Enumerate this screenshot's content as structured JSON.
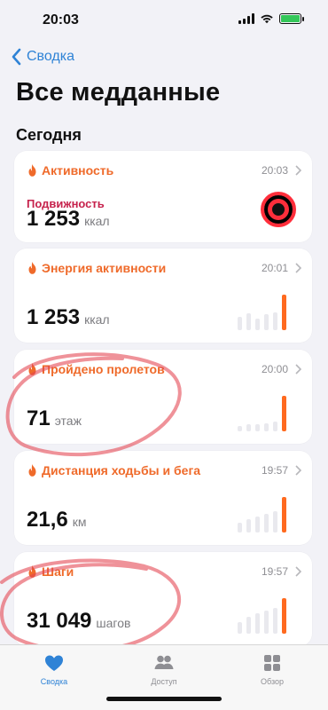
{
  "status": {
    "time": "20:03",
    "battery_color": "#34c759"
  },
  "nav": {
    "back_label": "Сводка",
    "title": "Все медданные",
    "section": "Сегодня"
  },
  "cards": [
    {
      "title": "Активность",
      "time": "20:03",
      "subtitle": "Подвижность",
      "value": "1 253",
      "unit": "ккал",
      "icon": "flame-icon",
      "accent": "#ef6a2a"
    },
    {
      "title": "Энергия активности",
      "time": "20:01",
      "value": "1 253",
      "unit": "ккал",
      "icon": "flame-icon",
      "sparkline": [
        0.35,
        0.45,
        0.3,
        0.42,
        0.48,
        0.95
      ]
    },
    {
      "title": "Пройдено пролетов",
      "time": "20:00",
      "value": "71",
      "unit": "этаж",
      "icon": "flame-icon",
      "sparkline": [
        0.15,
        0.2,
        0.18,
        0.22,
        0.27,
        0.95
      ]
    },
    {
      "title": "Дистанция ходьбы и бега",
      "time": "19:57",
      "value": "21,6",
      "unit": "км",
      "icon": "flame-icon",
      "sparkline": [
        0.25,
        0.35,
        0.42,
        0.5,
        0.58,
        0.95
      ]
    },
    {
      "title": "Шаги",
      "time": "19:57",
      "value": "31 049",
      "unit": "шагов",
      "icon": "flame-icon",
      "sparkline": [
        0.3,
        0.45,
        0.55,
        0.62,
        0.7,
        0.95
      ]
    }
  ],
  "tabs": [
    {
      "label": "Сводка",
      "icon": "heart-icon",
      "selected": true
    },
    {
      "label": "Доступ",
      "icon": "people-icon",
      "selected": false
    },
    {
      "label": "Обзор",
      "icon": "grid-icon",
      "selected": false
    }
  ],
  "colors": {
    "accent_blue": "#2f83d6",
    "health_orange": "#ef6a2a",
    "annotation_red": "#e3434f"
  }
}
